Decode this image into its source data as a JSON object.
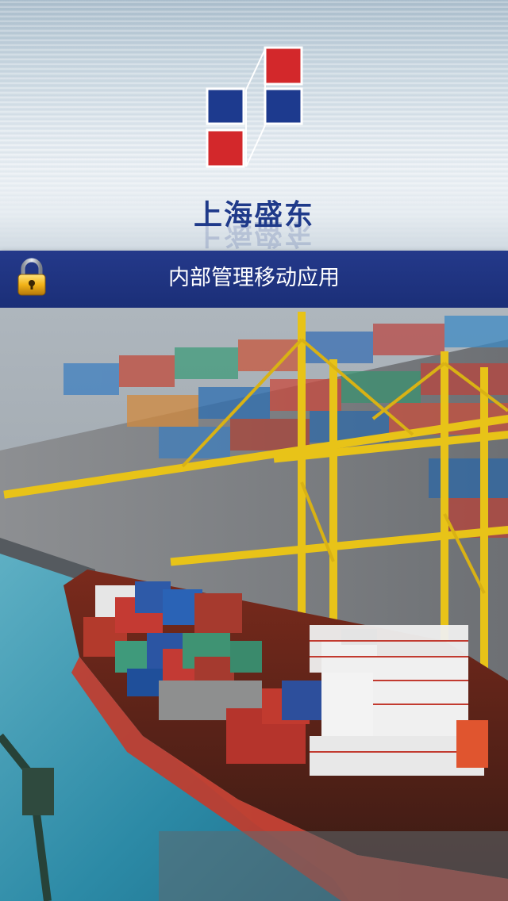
{
  "header": {
    "brand_name": "上海盛东",
    "logo_colors": {
      "red": "#d3282b",
      "blue": "#1d3a8e"
    }
  },
  "banner": {
    "title": "内部管理移动应用",
    "icon": "lock-icon",
    "background": "#1f3481"
  },
  "background_photo": {
    "subject": "container-port-icon"
  }
}
